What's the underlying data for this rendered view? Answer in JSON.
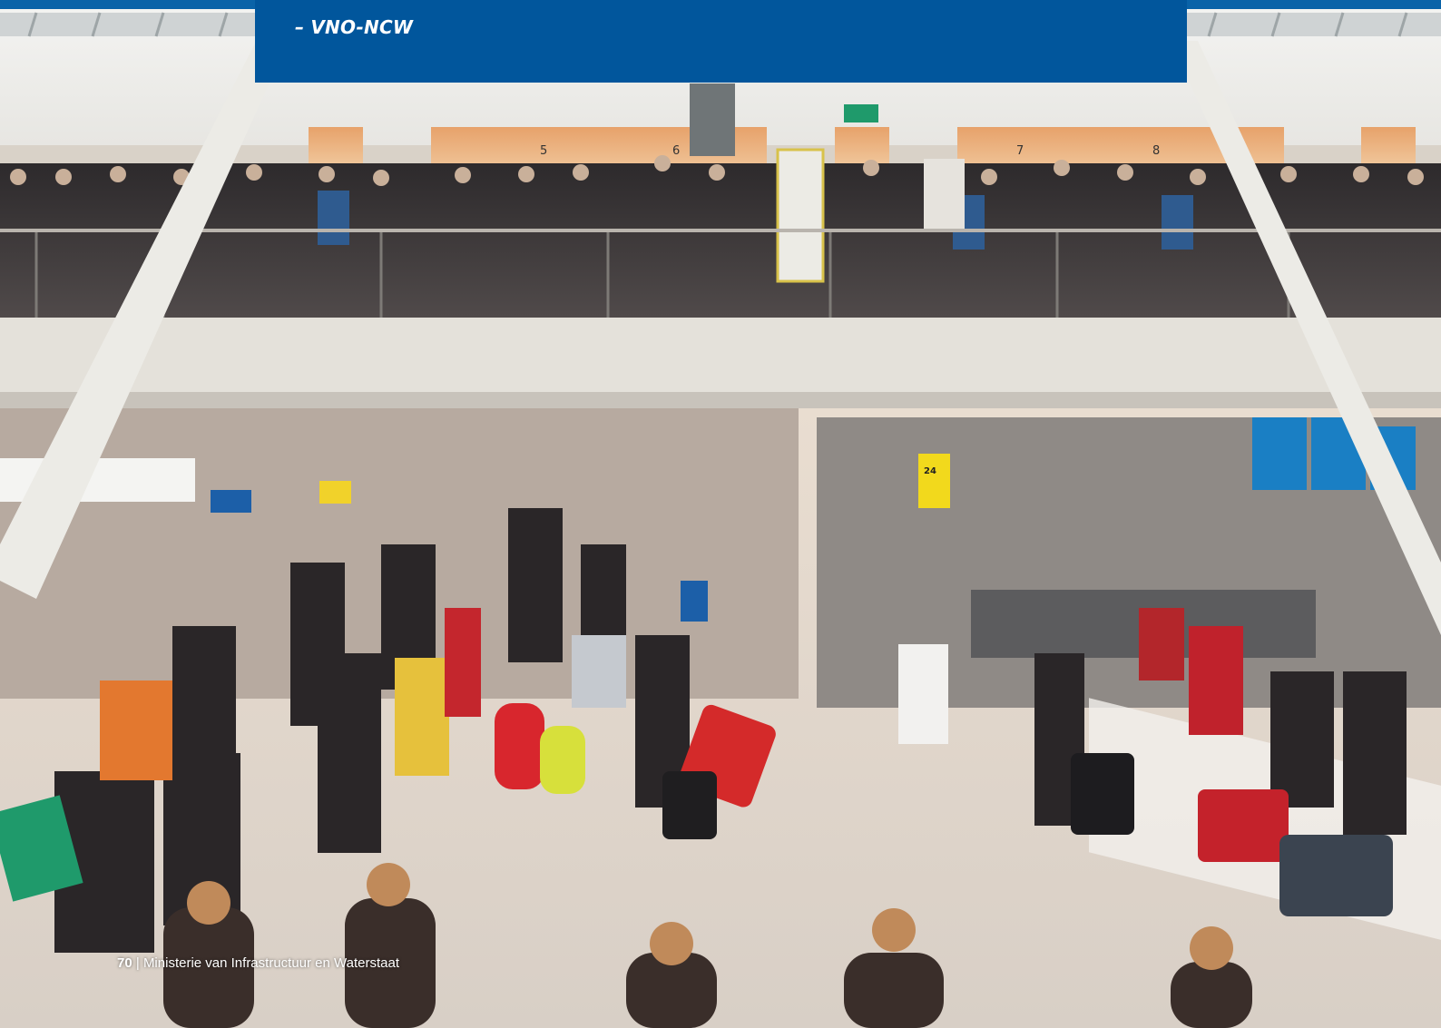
{
  "header": {
    "quote_attribution": "– VNO-NCW"
  },
  "footer": {
    "page_number": "70",
    "separator": "|",
    "publisher": "Ministerie van Infrastructuur en Waterstaat"
  },
  "photo": {
    "signs": {
      "gate_5": "5",
      "gate_6": "6",
      "gate_7": "7",
      "gate_8": "8",
      "counter_24": "24"
    }
  },
  "colors": {
    "brand_blue": "#01569c",
    "top_strip": "#0a63a8"
  }
}
